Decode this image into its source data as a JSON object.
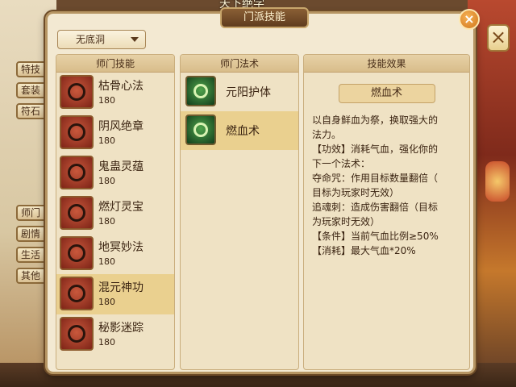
{
  "window": {
    "title": "门派技能",
    "close_symbol": "×",
    "background_title": "天下绝学"
  },
  "dropdown": {
    "value": "无底洞"
  },
  "side_buttons": [
    "特技",
    "套装",
    "符石",
    "师门",
    "剧情",
    "生活",
    "其他"
  ],
  "panels": {
    "skills_header": "师门技能",
    "spells_header": "师门法术",
    "effect_header": "技能效果"
  },
  "skills": [
    {
      "name": "枯骨心法",
      "level": "180",
      "icon": "skull-sigil-icon"
    },
    {
      "name": "阴风绝章",
      "level": "180",
      "icon": "wind-sigil-icon"
    },
    {
      "name": "鬼蛊灵蕴",
      "level": "180",
      "icon": "insect-sigil-icon"
    },
    {
      "name": "燃灯灵宝",
      "level": "180",
      "icon": "lamp-sigil-icon"
    },
    {
      "name": "地冥妙法",
      "level": "180",
      "icon": "underworld-sigil-icon"
    },
    {
      "name": "混元神功",
      "level": "180",
      "icon": "chaos-sigil-icon",
      "selected": true
    },
    {
      "name": "秘影迷踪",
      "level": "180",
      "icon": "shadow-sigil-icon"
    }
  ],
  "spells": [
    {
      "name": "元阳护体",
      "icon": "swirl-shield-icon"
    },
    {
      "name": "燃血术",
      "icon": "blood-flame-icon",
      "selected": true
    }
  ],
  "effect": {
    "title": "燃血术",
    "lines": [
      "以自身鲜血为祭，换取强大的",
      "法力。",
      "【功效】消耗气血，强化你的",
      "下一个法术：",
      "夺命咒：作用目标数量翻倍（",
      "目标为玩家时无效）",
      "追魂刺：造成伤害翻倍（目标",
      "为玩家时无效）",
      "【条件】当前气血比例≥50%",
      "【消耗】最大气血*20%"
    ]
  },
  "colors": {
    "panel_bg": "#efe2c4",
    "selected_bg": "#ead08f",
    "close_orange": "#d0761c"
  }
}
